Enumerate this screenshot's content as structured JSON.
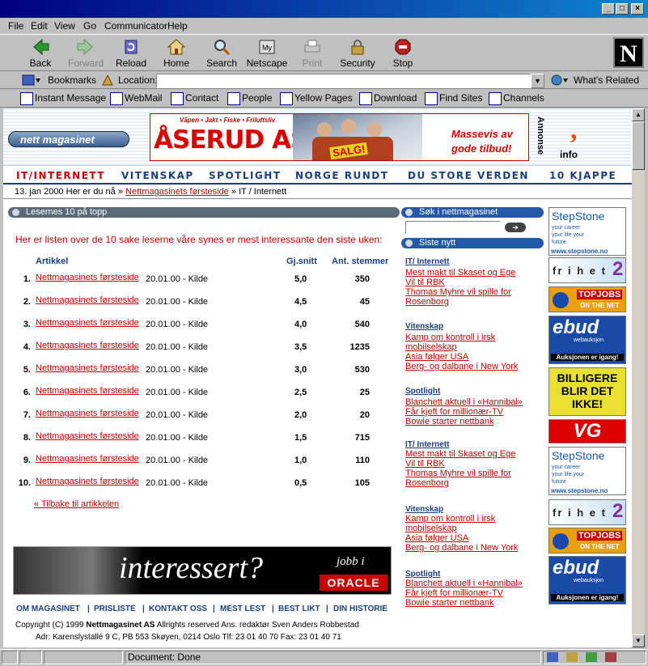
{
  "window": {
    "min": "_",
    "max": "□",
    "close": "×"
  },
  "menu": [
    "File",
    "Edit",
    "View",
    "Go",
    "Communicator",
    "Help"
  ],
  "toolbar": {
    "back": "Back",
    "forward": "Forward",
    "reload": "Reload",
    "home": "Home",
    "search": "Search",
    "netscape": "Netscape",
    "print": "Print",
    "security": "Security",
    "stop": "Stop",
    "logo": "N"
  },
  "location": {
    "bookmarks": "Bookmarks",
    "label": "Location:",
    "value": "",
    "whats_related": "What's Related"
  },
  "personal": [
    "Instant Message",
    "WebMail",
    "Contact",
    "People",
    "Yellow Pages",
    "Download",
    "Find Sites",
    "Channels"
  ],
  "page": {
    "logo": "nett magasinet",
    "banner": {
      "tag": "Våpen • Jakt • Fiske • Friluftsliv",
      "brand": "ÅSERUD AS",
      "sale": "SALG!",
      "offer": "Massevis av gode tilbud!",
      "annonse": "Annonse",
      "info": "info"
    },
    "nav": [
      "IT/INTERNETT",
      "VITENSKAP",
      "SPOTLIGHT",
      "NORGE RUNDT",
      "DU STORE VERDEN",
      "10 KJAPPE"
    ],
    "breadcrumb": {
      "date": "13. jan 2000",
      "here": "Her er du nå",
      "sep1": "»",
      "link": "Nettmagasinets førsteside",
      "sep2": "»",
      "current": "IT / Internett"
    },
    "section_title": "Lesernes 10 på topp",
    "intro": "Her er listen over de 10 sake leserne våre synes er mest interessante den siste uken:",
    "table": {
      "headers": [
        "Artikkel",
        "Gj.snitt",
        "Ant. stemmer"
      ],
      "rows": [
        {
          "rank": "1.",
          "title": "Nettmagasinets førsteside",
          "date": "20.01.00 - Kilde",
          "snitt": "5,0",
          "stemmer": "350"
        },
        {
          "rank": "2.",
          "title": "Nettmagasinets førsteside",
          "date": "20.01.00 - Kilde",
          "snitt": "4,5",
          "stemmer": "45"
        },
        {
          "rank": "3.",
          "title": "Nettmagasinets førsteside",
          "date": "20.01.00 - Kilde",
          "snitt": "4,0",
          "stemmer": "540"
        },
        {
          "rank": "4.",
          "title": "Nettmagasinets førsteside",
          "date": "20.01.00 - Kilde",
          "snitt": "3,5",
          "stemmer": "1235"
        },
        {
          "rank": "5.",
          "title": "Nettmagasinets førsteside",
          "date": "20.01.00 - Kilde",
          "snitt": "3,0",
          "stemmer": "530"
        },
        {
          "rank": "6.",
          "title": "Nettmagasinets førsteside",
          "date": "20.01.00 - Kilde",
          "snitt": "2,5",
          "stemmer": "25"
        },
        {
          "rank": "7.",
          "title": "Nettmagasinets førsteside",
          "date": "20.01.00 - Kilde",
          "snitt": "2,0",
          "stemmer": "20"
        },
        {
          "rank": "8.",
          "title": "Nettmagasinets førsteside",
          "date": "20.01.00 - Kilde",
          "snitt": "1,5",
          "stemmer": "715"
        },
        {
          "rank": "9.",
          "title": "Nettmagasinets førsteside",
          "date": "20.01.00 - Kilde",
          "snitt": "1,0",
          "stemmer": "110"
        },
        {
          "rank": "10.",
          "title": "Nettmagasinets førsteside",
          "date": "20.01.00 - Kilde",
          "snitt": "0,5",
          "stemmer": "105"
        }
      ]
    },
    "back_link": "« Tilbake til artikkelen",
    "oracle": {
      "main": "interessert?",
      "jobb": "jobb i",
      "brand": "ORACLE"
    },
    "footer_links": [
      "OM MAGASINET",
      "PRISLISTE",
      "KONTAKT OSS",
      "MEST LEST",
      "BEST LIKT",
      "DIN HISTORIE"
    ],
    "footer_sep": "|",
    "copyright_pre": "Copyright (C) 1999 ",
    "copyright_bold": "Nettmagasinet AS",
    "copyright_post": " Allrights reserved Ans. redaktør Sven Anders Robbestad",
    "address": "Adr: Karenslystallé 9 C, PB 553 Skøyen, 0214 Oslo Tlf: 23 01 40 70 Fax: 23 01 40 71",
    "search_title": "Søk i nettmagasinet",
    "search_value": "",
    "sisteny_title": "Siste nytt",
    "sections": [
      {
        "title": "IT/ Internett",
        "items": [
          "Mest makt til Skaset og Ege",
          "Vil til RBK",
          "Thomas Myhre vil spille for Rosenborg"
        ]
      },
      {
        "title": "Vitenskap",
        "items": [
          "Kamp om kontroll i irsk mobilselskap",
          "Asia følger USA",
          "Berg- og dalbane i New York"
        ]
      },
      {
        "title": "Spotlight",
        "items": [
          "Blanchett aktuell i «Hannibal»",
          "Får kjeft for millionær-TV",
          "Bowie starter nettbank"
        ]
      },
      {
        "title": "IT/ Internett",
        "items": [
          "Mest makt til Skaset og Ege",
          "Vil til RBK",
          "Thomas Myhre vil spille for Rosenborg"
        ]
      },
      {
        "title": "Vitenskap",
        "items": [
          "Kamp om kontroll i irsk mobilselskap",
          "Asia følger USA",
          "Berg- og dalbane i New York"
        ]
      },
      {
        "title": "Spotlight",
        "items": [
          "Blanchett aktuell i «Hannibal»",
          "Får kjeft for millionær-TV",
          "Bowie starter nettbank"
        ]
      }
    ],
    "ads": {
      "stepstone": "StepStone",
      "stepstone_tag": "your career your life your future",
      "stepstone_url": "www.stepstone.no",
      "frihet": "fr i h e t",
      "frihet_num": "2",
      "topjobs": "TOPJOBS",
      "topjobs_sub": "ON THE NET",
      "ebud": "ebud",
      "ebud_sub": "webauksjon",
      "ebud_tag": "Auksjonen er igang!",
      "billigere": "BILLIGERE BLIR DET IKKE!",
      "vg": "VG"
    }
  },
  "status": {
    "text": "Document: Done"
  }
}
